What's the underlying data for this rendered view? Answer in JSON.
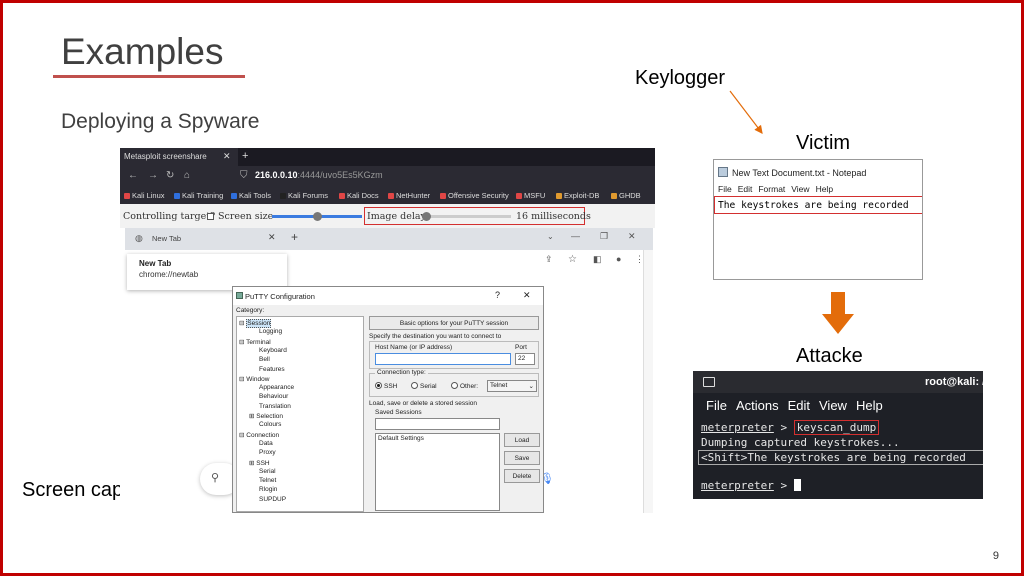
{
  "slide": {
    "title": "Examples",
    "subtitle": "Deploying a Spyware",
    "page_number": "9",
    "labels": {
      "keylogger": "Keylogger",
      "victim": "Victim",
      "attacker": "Attacke",
      "screen_capture": "Screen capture"
    },
    "colors": {
      "border": "#c00000",
      "accent": "#c0504d",
      "arrow": "#e36c0a",
      "highlight": "#d32f2f"
    }
  },
  "screen_capture": {
    "browser": {
      "tab_title": "Metasploit screenshare",
      "url_host": "216.0.0.10",
      "url_rest": ":4444/uvo5Es5KGzm",
      "bookmarks": [
        {
          "label": "Kali Linux",
          "color": "#e04646"
        },
        {
          "label": "Kali Training",
          "color": "#2f6fde"
        },
        {
          "label": "Kali Tools",
          "color": "#2f6fde"
        },
        {
          "label": "Kali Forums",
          "color": "#222222"
        },
        {
          "label": "Kali Docs",
          "color": "#e04646"
        },
        {
          "label": "NetHunter",
          "color": "#e04646"
        },
        {
          "label": "Offensive Security",
          "color": "#e04646"
        },
        {
          "label": "MSFU",
          "color": "#e04646"
        },
        {
          "label": "Exploit-DB",
          "color": "#e09a2f"
        },
        {
          "label": "GHDB",
          "color": "#e09a2f"
        }
      ]
    },
    "controls": {
      "controlling_label": "Controlling target?",
      "screen_size_label": "Screen size",
      "image_delay_label": "Image delay",
      "delay_value": "16 milliseconds"
    },
    "chrome": {
      "tab_label": "New Tab",
      "card_title": "New Tab",
      "card_url": "chrome://newtab"
    },
    "putty": {
      "title": "PuTTY Configuration",
      "help": "?",
      "category_label": "Category:",
      "tree": [
        {
          "label": "Session",
          "level": 0,
          "expander": "⊟",
          "selected": true
        },
        {
          "label": "Logging",
          "level": 1
        },
        {
          "label": "Terminal",
          "level": 0,
          "expander": "⊟"
        },
        {
          "label": "Keyboard",
          "level": 1
        },
        {
          "label": "Bell",
          "level": 1
        },
        {
          "label": "Features",
          "level": 1
        },
        {
          "label": "Window",
          "level": 0,
          "expander": "⊟"
        },
        {
          "label": "Appearance",
          "level": 1
        },
        {
          "label": "Behaviour",
          "level": 1
        },
        {
          "label": "Translation",
          "level": 1
        },
        {
          "label": "Selection",
          "level": 1,
          "expander": "⊞"
        },
        {
          "label": "Colours",
          "level": 1
        },
        {
          "label": "Connection",
          "level": 0,
          "expander": "⊟"
        },
        {
          "label": "Data",
          "level": 1
        },
        {
          "label": "Proxy",
          "level": 1
        },
        {
          "label": "SSH",
          "level": 1,
          "expander": "⊞"
        },
        {
          "label": "Serial",
          "level": 1
        },
        {
          "label": "Telnet",
          "level": 1
        },
        {
          "label": "Rlogin",
          "level": 1
        },
        {
          "label": "SUPDUP",
          "level": 1
        }
      ],
      "section_header": "Basic options for your PuTTY session",
      "destination_label": "Specify the destination you want to connect to",
      "host_label": "Host Name (or IP address)",
      "port_label": "Port",
      "port_value": "22",
      "connection_type_label": "Connection type:",
      "conn_ssh": "SSH",
      "conn_serial": "Serial",
      "conn_other": "Other:",
      "conn_other_value": "Telnet",
      "load_save_label": "Load, save or delete a stored session",
      "saved_sessions_label": "Saved Sessions",
      "default_settings": "Default Settings",
      "btn_load": "Load",
      "btn_save": "Save",
      "btn_delete": "Delete"
    }
  },
  "victim": {
    "notepad_title": "New Text Document.txt - Notepad",
    "menu": [
      "File",
      "Edit",
      "Format",
      "View",
      "Help"
    ],
    "text": "The keystrokes are being recorded"
  },
  "attacker": {
    "title": "root@kali: /",
    "menu": [
      "File",
      "Actions",
      "Edit",
      "View",
      "Help"
    ],
    "prompt": "meterpreter",
    "command": "keyscan_dump",
    "line2": "Dumping captured keystrokes...",
    "line3": "<Shift>The keystrokes are being recorded",
    "prompt2": "meterpreter"
  }
}
